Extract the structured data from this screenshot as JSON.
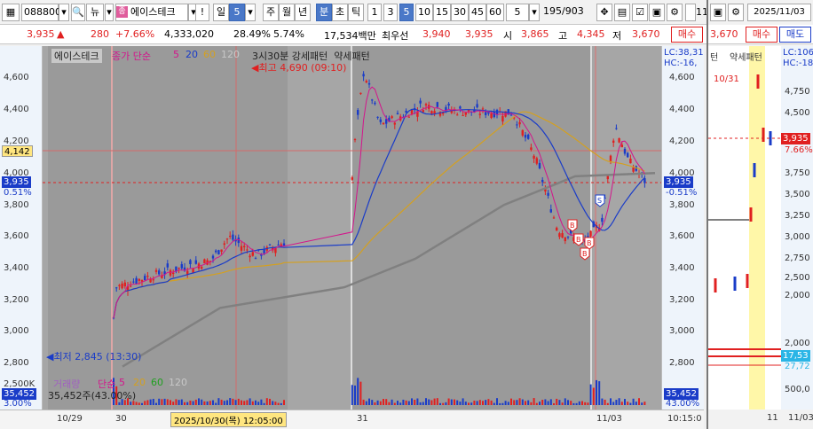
{
  "toolbar": {
    "code": "088800",
    "name": "에이스테크",
    "periods": [
      "일",
      "5",
      "주",
      "월",
      "년",
      "분",
      "초",
      "틱"
    ],
    "selected_period": "5",
    "intervals": [
      "1",
      "3",
      "5",
      "10",
      "15",
      "30",
      "45",
      "60"
    ],
    "selected_interval": "5",
    "interval_box": "5",
    "count": "195",
    "count_total": "/903",
    "right_date": "2025/11/03",
    "right_partial": "11/"
  },
  "info": {
    "price": "3,935",
    "change": "280",
    "change_pct": "+7.66%",
    "volume": "4,333,020",
    "turnover_pct": "28.49%",
    "ratio": "5.74%",
    "amount": "17,534백만",
    "hoga_label": "최우선",
    "ask": "3,940",
    "bid": "3,935",
    "open_label": "시",
    "open": "3,865",
    "high_label": "고",
    "high": "4,345",
    "low_label": "저",
    "low": "3,670",
    "buy_label": "매수",
    "right_price": "3,670",
    "right_buy": "매수",
    "right_sell": "매도"
  },
  "chart": {
    "legend_name": "에이스테크",
    "legend_ma": "종가 단순",
    "ma_values": [
      "5",
      "20",
      "60",
      "120"
    ],
    "signals": "3시30분 강세패턴  약세패턴",
    "high_note": "최고 4,690 (09:10)",
    "low_note": "최저 2,845 (13:30)",
    "lc": "LC:38,31",
    "hc": "HC:-16,",
    "current_tag": "3,935",
    "current_pct": "0.51%",
    "current_pct_right": "-0.51%",
    "left_tag": "4,142",
    "y_ticks": [
      "4,600",
      "4,400",
      "4,200",
      "4,000",
      "3,800",
      "3,600",
      "3,400",
      "3,200",
      "3,000",
      "2,800"
    ],
    "vol_label": "거래량",
    "vol_ma": "단순",
    "vol_ma_values": [
      "5",
      "20",
      "60",
      "120"
    ],
    "vol_value": "35,452주(43.00%)",
    "vol_tick": "2,500K",
    "vol_box": "35,452",
    "vol_pct": "3.00%",
    "vol_pct_right": "43.00%"
  },
  "xaxis": {
    "labels": [
      "10/29",
      "30",
      "31",
      "11/03",
      "10:15:0"
    ],
    "cursor_date": "2025/10/30(목) 12:05:00"
  },
  "right_panel": {
    "date_note": "10/31",
    "lc": "LC:106",
    "hc": "HC:-18",
    "price_tag": "3,935",
    "pct": "7.66%",
    "signal_label": "턴",
    "signal2": "약세패턴",
    "y_ticks": [
      "4,750",
      "4,500",
      "4,250",
      "4,000",
      "3,750",
      "3,500",
      "3,250",
      "3,000",
      "2,750",
      "2,500",
      "2,250",
      "2,000"
    ],
    "vol_ticks": [
      "2,000",
      "1,000",
      "500,0"
    ],
    "vol_box": "17,53",
    "vol_box2": "27,72",
    "x_labels": [
      "11",
      "11/03"
    ]
  },
  "colors": {
    "up": "#e02020",
    "down": "#1a3cc8",
    "ma5": "#d4148c",
    "ma20": "#1a3cc8",
    "ma60": "#d4a020",
    "ma120": "#808080",
    "current": "#1a3cc8"
  }
}
